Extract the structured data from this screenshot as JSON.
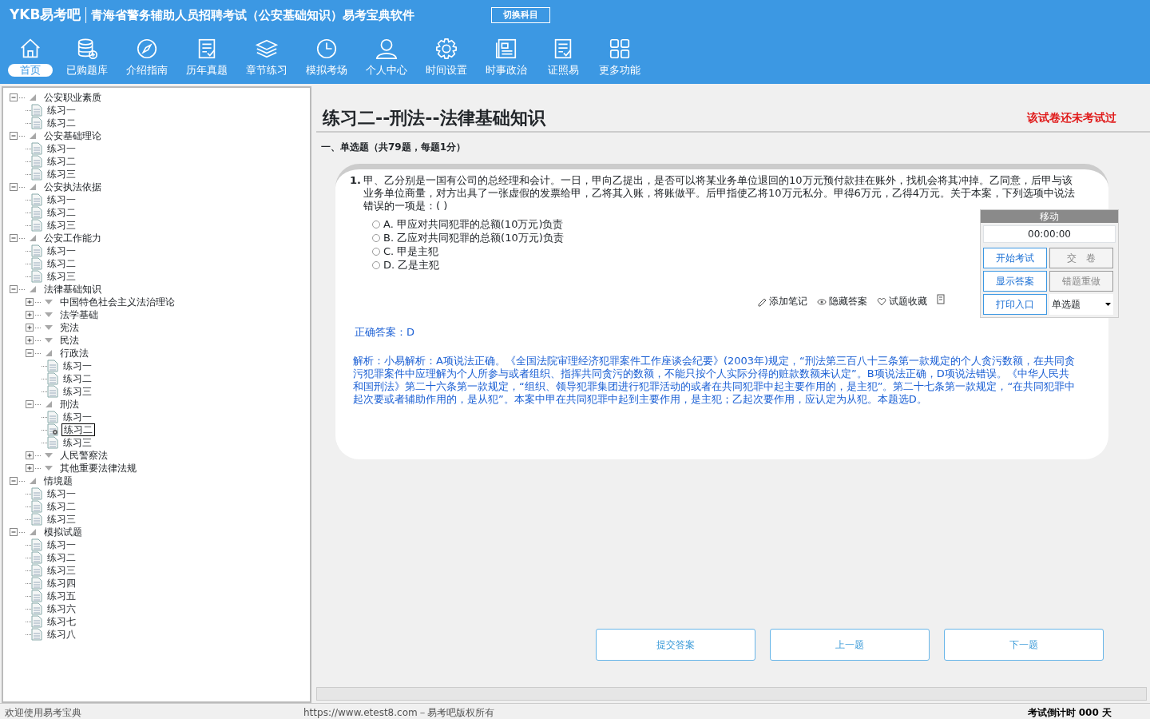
{
  "header": {
    "logo": "YKB易考吧",
    "title": "青海省警务辅助人员招聘考试（公安基础知识）易考宝典软件",
    "switch_button": "切换科目"
  },
  "nav": [
    {
      "label": "首页",
      "selected": true
    },
    {
      "label": "已购题库",
      "selected": false
    },
    {
      "label": "介绍指南",
      "selected": false
    },
    {
      "label": "历年真题",
      "selected": false
    },
    {
      "label": "章节练习",
      "selected": false
    },
    {
      "label": "模拟考场",
      "selected": false
    },
    {
      "label": "个人中心",
      "selected": false
    },
    {
      "label": "时间设置",
      "selected": false
    },
    {
      "label": "时事政治",
      "selected": false
    },
    {
      "label": "证照易",
      "selected": false
    },
    {
      "label": "更多功能",
      "selected": false
    }
  ],
  "tree": [
    {
      "label": "公安职业素质",
      "expanded": true,
      "children": [
        {
          "label": "练习一",
          "selected": false
        },
        {
          "label": "练习二",
          "selected": false
        }
      ]
    },
    {
      "label": "公安基础理论",
      "expanded": true,
      "children": [
        {
          "label": "练习一",
          "selected": false
        },
        {
          "label": "练习二",
          "selected": false
        },
        {
          "label": "练习三",
          "selected": false
        }
      ]
    },
    {
      "label": "公安执法依据",
      "expanded": true,
      "children": [
        {
          "label": "练习一",
          "selected": false
        },
        {
          "label": "练习二",
          "selected": false
        },
        {
          "label": "练习三",
          "selected": false
        }
      ]
    },
    {
      "label": "公安工作能力",
      "expanded": true,
      "children": [
        {
          "label": "练习一",
          "selected": false
        },
        {
          "label": "练习二",
          "selected": false
        },
        {
          "label": "练习三",
          "selected": false
        }
      ]
    },
    {
      "label": "法律基础知识",
      "expanded": true,
      "children": [
        {
          "label": "中国特色社会主义法治理论",
          "expanded": false
        },
        {
          "label": "法学基础",
          "expanded": false
        },
        {
          "label": "宪法",
          "expanded": false
        },
        {
          "label": "民法",
          "expanded": false
        },
        {
          "label": "行政法",
          "expanded": true,
          "children": [
            {
              "label": "练习一",
              "selected": false
            },
            {
              "label": "练习二",
              "selected": false
            },
            {
              "label": "练习三",
              "selected": false
            }
          ]
        },
        {
          "label": "刑法",
          "expanded": true,
          "children": [
            {
              "label": "练习一",
              "selected": false
            },
            {
              "label": "练习二",
              "selected": true
            },
            {
              "label": "练习三",
              "selected": false
            }
          ]
        },
        {
          "label": "人民警察法",
          "expanded": false
        },
        {
          "label": "其他重要法律法规",
          "expanded": false
        }
      ]
    },
    {
      "label": "情境题",
      "expanded": true,
      "children": [
        {
          "label": "练习一",
          "selected": false
        },
        {
          "label": "练习二",
          "selected": false
        },
        {
          "label": "练习三",
          "selected": false
        }
      ]
    },
    {
      "label": "模拟试题",
      "expanded": true,
      "children": [
        {
          "label": "练习一",
          "selected": false
        },
        {
          "label": "练习二",
          "selected": false
        },
        {
          "label": "练习三",
          "selected": false
        },
        {
          "label": "练习四",
          "selected": false
        },
        {
          "label": "练习五",
          "selected": false
        },
        {
          "label": "练习六",
          "selected": false
        },
        {
          "label": "练习七",
          "selected": false
        },
        {
          "label": "练习八",
          "selected": false
        }
      ]
    }
  ],
  "exam": {
    "title": "练习二--刑法--法律基础知识",
    "status": "该试卷还未考试过",
    "section": "一、单选题（共79题，每题1分）",
    "question": {
      "number": "1.",
      "text": "甲、乙分别是一国有公司的总经理和会计。一日，甲向乙提出，是否可以将某业务单位退回的10万元预付款挂在账外，找机会将其冲掉。乙同意，后甲与该业务单位商量，对方出具了一张虚假的发票给甲，乙将其入账，将账做平。后甲指使乙将10万元私分。甲得6万元，乙得4万元。关于本案，下列选项中说法错误的一项是：( )",
      "options": [
        {
          "letter": "A.",
          "text": "甲应对共同犯罪的总额(10万元)负责",
          "selected": false
        },
        {
          "letter": "B.",
          "text": "乙应对共同犯罪的总额(10万元)负责",
          "selected": false
        },
        {
          "letter": "C.",
          "text": "甲是主犯",
          "selected": false
        },
        {
          "letter": "D.",
          "text": "乙是主犯",
          "selected": false
        }
      ]
    },
    "tools": [
      "添加笔记",
      "隐藏答案",
      "试题收藏"
    ],
    "answer": "正确答案：D",
    "analysis": "解析：小易解析：A项说法正确。《全国法院审理经济犯罪案件工作座谈会纪要》(2003年)规定，“刑法第三百八十三条第一款规定的个人贪污数额，在共同贪污犯罪案件中应理解为个人所参与或者组织、指挥共同贪污的数额，不能只按个人实际分得的赃款数额来认定”。B项说法正确，D项说法错误。《中华人民共和国刑法》第二十六条第一款规定，“组织、领导犯罪集团进行犯罪活动的或者在共同犯罪中起主要作用的，是主犯”。第二十七条第一款规定，“在共同犯罪中起次要或者辅助作用的，是从犯”。本案中甲在共同犯罪中起到主要作用，是主犯；乙起次要作用，应认定为从犯。本题选D。",
    "buttons": [
      "提交答案",
      "上一题",
      "下一题"
    ]
  },
  "panel": {
    "header": "移动",
    "timer": "00:00:00",
    "buttons": [
      "开始考试",
      "交　卷",
      "显示答案",
      "错题重做",
      "打印入口"
    ],
    "type_select": "单选题"
  },
  "status_bar": {
    "welcome": "欢迎使用易考宝典",
    "copyright": "https://www.etest8.com－易考吧版权所有",
    "countdown": "考试倒计时 000 天"
  }
}
